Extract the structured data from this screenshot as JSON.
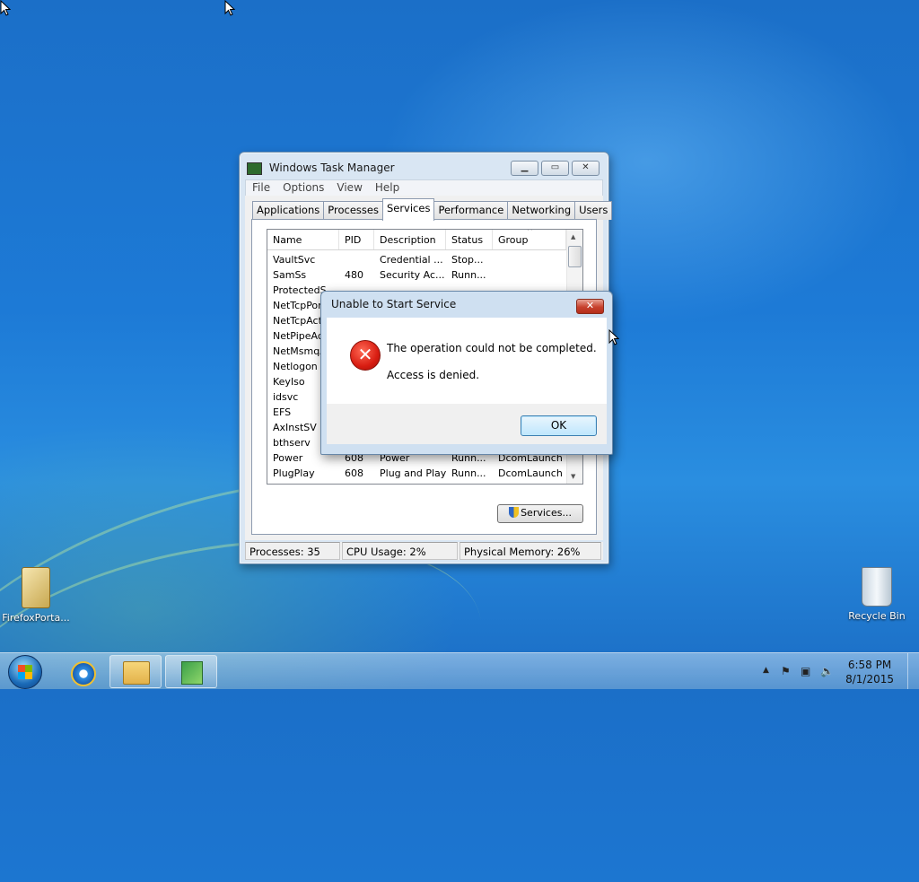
{
  "desktop": {
    "icons": [
      {
        "label": "FirefoxPorta..."
      },
      {
        "label": "Recycle Bin"
      }
    ]
  },
  "task_manager": {
    "title": "Windows Task Manager",
    "menu": [
      "File",
      "Options",
      "View",
      "Help"
    ],
    "tabs": [
      "Applications",
      "Processes",
      "Services",
      "Performance",
      "Networking",
      "Users"
    ],
    "active_tab": "Services",
    "columns": [
      "Name",
      "PID",
      "Description",
      "Status",
      "Group"
    ],
    "rows": [
      {
        "name": "VaultSvc",
        "pid": "",
        "desc": "Credential ...",
        "status": "Stop...",
        "group": ""
      },
      {
        "name": "SamSs",
        "pid": "480",
        "desc": "Security Ac...",
        "status": "Runn...",
        "group": ""
      },
      {
        "name": "ProtectedS",
        "pid": "",
        "desc": "",
        "status": "",
        "group": ""
      },
      {
        "name": "NetTcpPort",
        "pid": "",
        "desc": "",
        "status": "",
        "group": ""
      },
      {
        "name": "NetTcpActi",
        "pid": "",
        "desc": "",
        "status": "",
        "group": ""
      },
      {
        "name": "NetPipeAct",
        "pid": "",
        "desc": "",
        "status": "",
        "group": ""
      },
      {
        "name": "NetMsmqA",
        "pid": "",
        "desc": "",
        "status": "",
        "group": ""
      },
      {
        "name": "Netlogon",
        "pid": "",
        "desc": "",
        "status": "",
        "group": ""
      },
      {
        "name": "KeyIso",
        "pid": "",
        "desc": "",
        "status": "",
        "group": ""
      },
      {
        "name": "idsvc",
        "pid": "",
        "desc": "",
        "status": "",
        "group": ""
      },
      {
        "name": "EFS",
        "pid": "",
        "desc": "",
        "status": "",
        "group": ""
      },
      {
        "name": "AxInstSV",
        "pid": "",
        "desc": "",
        "status": "",
        "group": ""
      },
      {
        "name": "bthserv",
        "pid": "",
        "desc": "",
        "status": "",
        "group": ""
      },
      {
        "name": "Power",
        "pid": "608",
        "desc": "Power",
        "status": "Runn...",
        "group": "DcomLaunch"
      },
      {
        "name": "PlugPlay",
        "pid": "608",
        "desc": "Plug and Play",
        "status": "Runn...",
        "group": "DcomLaunch"
      }
    ],
    "services_button": "Services...",
    "status": {
      "processes": "Processes: 35",
      "cpu": "CPU Usage: 2%",
      "memory": "Physical Memory: 26%"
    }
  },
  "dialog": {
    "title": "Unable to Start Service",
    "close": "✕",
    "message": "The operation could not be completed.",
    "detail": "Access is denied.",
    "ok_label": "OK"
  },
  "taskbar": {
    "time": "6:58 PM",
    "date": "8/1/2015"
  }
}
